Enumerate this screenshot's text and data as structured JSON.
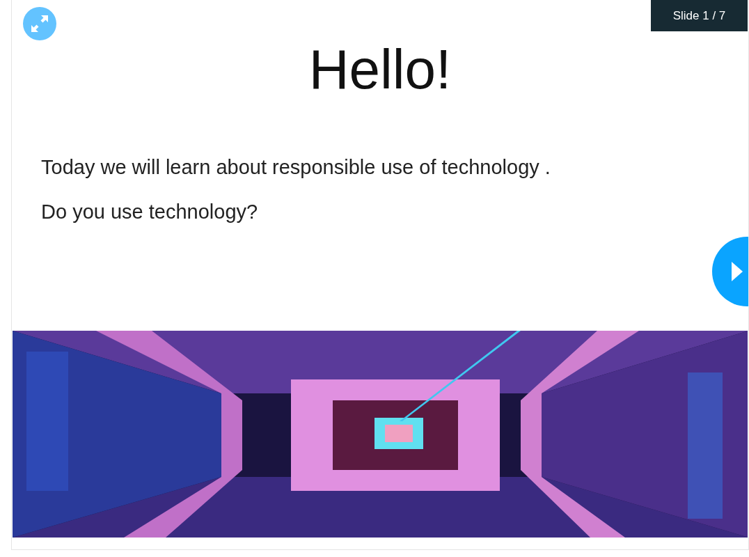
{
  "slide_counter": "Slide 1 / 7",
  "slide": {
    "title": "Hello!",
    "paragraphs": [
      "Today we will learn about responsible use of technology .",
      "Do you use technology?"
    ]
  }
}
